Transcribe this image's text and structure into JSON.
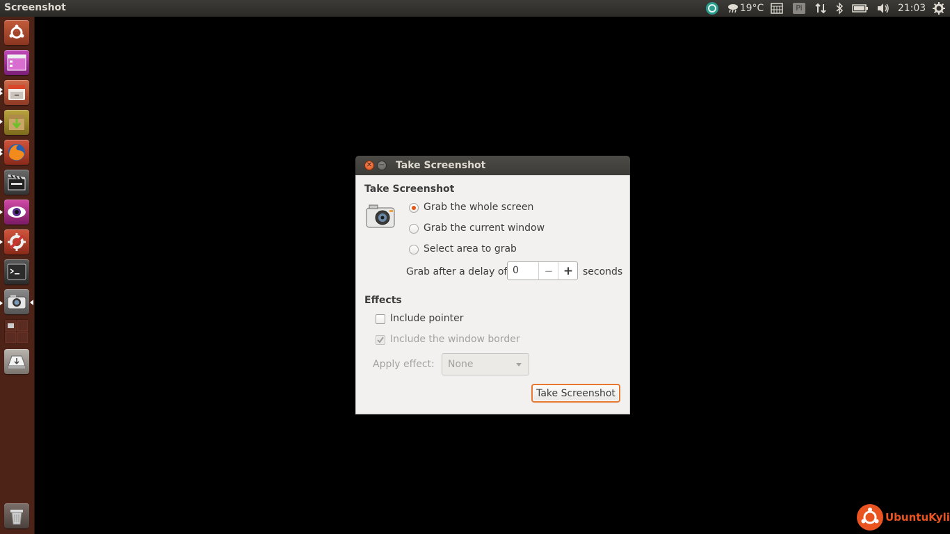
{
  "top_panel": {
    "app_title": "Screenshot",
    "temperature": "19°C",
    "keyboard_indicator": "Pi",
    "clock": "21:03"
  },
  "launcher": {
    "items": [
      {
        "icon": "dash-icon"
      },
      {
        "icon": "workspace-switcher-icon"
      },
      {
        "icon": "file-manager-icon"
      },
      {
        "icon": "archive-installer-icon"
      },
      {
        "icon": "firefox-icon"
      },
      {
        "icon": "video-editor-icon"
      },
      {
        "icon": "eye-app-icon"
      },
      {
        "icon": "system-settings-icon"
      },
      {
        "icon": "terminal-icon"
      },
      {
        "icon": "screenshot-app-icon"
      },
      {
        "icon": "workspaces-icon"
      },
      {
        "icon": "usb-drive-icon"
      },
      {
        "icon": "trash-icon"
      }
    ]
  },
  "dialog": {
    "window_title": "Take Screenshot",
    "section_title": "Take Screenshot",
    "grab_options": [
      {
        "label": "Grab the whole screen",
        "checked": true
      },
      {
        "label": "Grab the current window",
        "checked": false
      },
      {
        "label": "Select area to grab",
        "checked": false
      }
    ],
    "delay_label": "Grab after a delay of",
    "delay_value": "0",
    "delay_unit": "seconds",
    "minus_label": "−",
    "plus_label": "+",
    "effects_title": "Effects",
    "include_pointer_label": "Include pointer",
    "include_pointer_checked": false,
    "include_border_label": "Include the window border",
    "include_border_checked": true,
    "apply_effect_label": "Apply effect:",
    "apply_effect_value": "None",
    "take_button_label": "Take Screenshot"
  },
  "branding": {
    "logo_text": "UbuntuKylin",
    "color": "#e95420"
  }
}
